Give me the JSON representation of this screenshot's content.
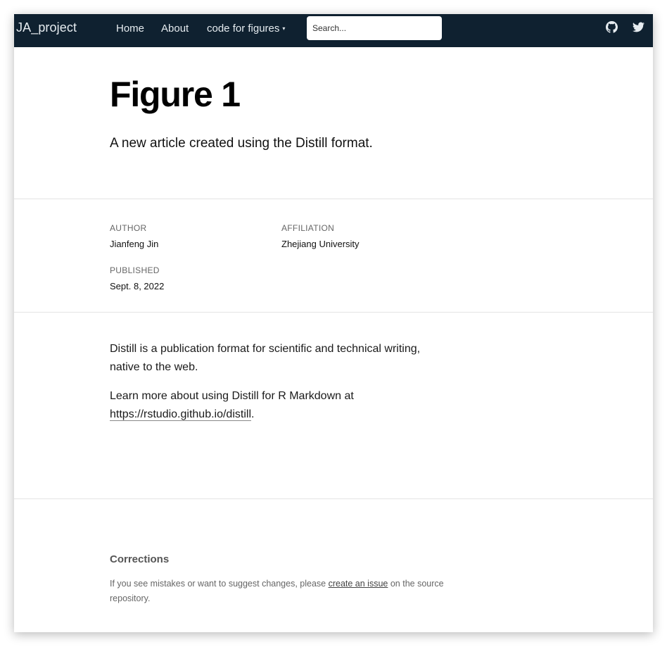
{
  "navbar": {
    "brand": "JA_project",
    "links": [
      {
        "label": "Home"
      },
      {
        "label": "About"
      },
      {
        "label": "code for figures",
        "dropdown_caret": "▾"
      }
    ],
    "search_placeholder": "Search...",
    "icons": [
      "github-icon",
      "twitter-icon"
    ],
    "background_color": "#0f2130"
  },
  "article": {
    "title": "Figure 1",
    "description": "A new article created using the Distill format."
  },
  "meta": {
    "author_label": "AUTHOR",
    "author": "Jianfeng Jin",
    "affiliation_label": "AFFILIATION",
    "affiliation": "Zhejiang University",
    "published_label": "PUBLISHED",
    "published": "Sept. 8, 2022"
  },
  "body": {
    "p1": "Distill is a publication format for scientific and technical writing, native to the web.",
    "p2_prefix": "Learn more about using Distill for R Markdown at ",
    "p2_link": "https://rstudio.github.io/distill",
    "p2_suffix": "."
  },
  "footer": {
    "corrections_title": "Corrections",
    "corrections_prefix": "If you see mistakes or want to suggest changes, please ",
    "corrections_link": "create an issue",
    "corrections_suffix": " on the source repository."
  }
}
